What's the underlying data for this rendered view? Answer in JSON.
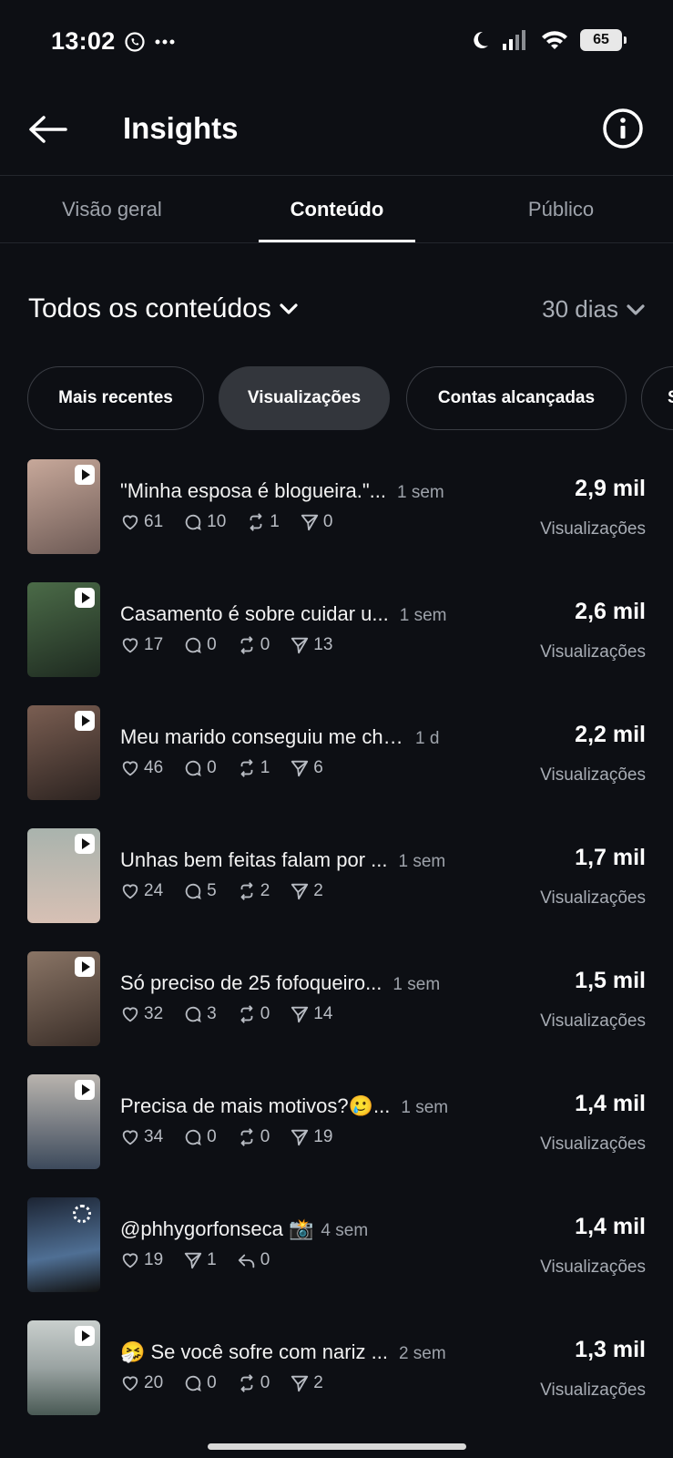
{
  "status_bar": {
    "time": "13:02",
    "battery": "65",
    "icons": [
      "whatsapp-icon",
      "more-dots-icon",
      "moon-icon",
      "signal-icon",
      "wifi-icon",
      "battery-icon"
    ]
  },
  "header": {
    "title": "Insights",
    "back_icon": "arrow-left-icon",
    "info_icon": "info-icon"
  },
  "tabs": [
    {
      "label": "Visão geral",
      "active": false
    },
    {
      "label": "Conteúdo",
      "active": true
    },
    {
      "label": "Público",
      "active": false
    }
  ],
  "filters": {
    "content_label": "Todos os conteúdos",
    "period_label": "30 dias"
  },
  "chips": [
    {
      "label": "Mais recentes",
      "active": false
    },
    {
      "label": "Visualizações",
      "active": true
    },
    {
      "label": "Contas alcançadas",
      "active": false
    },
    {
      "label": "S",
      "active": false
    }
  ],
  "posts": [
    {
      "title": "\"Minha esposa é blogueira.\"...",
      "age": "1 sem",
      "likes": "61",
      "comments": "10",
      "reposts": "1",
      "shares": "0",
      "value": "2,9 mil",
      "label": "Visualizações",
      "media": "video",
      "thumb_colors": [
        "#c7a89a",
        "#6d5a55"
      ]
    },
    {
      "title": "Casamento é sobre cuidar u...",
      "age": "1 sem",
      "likes": "17",
      "comments": "0",
      "reposts": "0",
      "shares": "13",
      "value": "2,6 mil",
      "label": "Visualizações",
      "media": "video",
      "thumb_colors": [
        "#4b6b48",
        "#1e2a20"
      ]
    },
    {
      "title": "Meu marido conseguiu me cha...",
      "age": "1 d",
      "likes": "46",
      "comments": "0",
      "reposts": "1",
      "shares": "6",
      "value": "2,2 mil",
      "label": "Visualizações",
      "media": "video",
      "thumb_colors": [
        "#7a5e52",
        "#2c2320"
      ]
    },
    {
      "title": "Unhas bem feitas falam por ...",
      "age": "1 sem",
      "likes": "24",
      "comments": "5",
      "reposts": "2",
      "shares": "2",
      "value": "1,7 mil",
      "label": "Visualizações",
      "media": "video",
      "thumb_colors": [
        "#a9b3ad",
        "#d7c0b4"
      ]
    },
    {
      "title": "Só preciso de 25 fofoqueiro...",
      "age": "1 sem",
      "likes": "32",
      "comments": "3",
      "reposts": "0",
      "shares": "14",
      "value": "1,5 mil",
      "label": "Visualizações",
      "media": "video",
      "thumb_colors": [
        "#8a7566",
        "#3a2e28"
      ]
    },
    {
      "title": "Precisa de mais motivos?🥲...",
      "age": "1 sem",
      "likes": "34",
      "comments": "0",
      "reposts": "0",
      "shares": "19",
      "value": "1,4 mil",
      "label": "Visualizações",
      "media": "video",
      "thumb_colors": [
        "#b9b4ae",
        "#3d4a5c"
      ]
    },
    {
      "title": "@phhygorfonseca 📸",
      "age": "4 sem",
      "likes": "19",
      "shares": "1",
      "replies": "0",
      "value": "1,4 mil",
      "label": "Visualizações",
      "media": "photo",
      "thumb_colors": [
        "#1c2433",
        "#4f6f94"
      ]
    },
    {
      "title": "🤧 Se você sofre com nariz ...",
      "age": "2 sem",
      "likes": "20",
      "comments": "0",
      "reposts": "0",
      "shares": "2",
      "value": "1,3 mil",
      "label": "Visualizações",
      "media": "video",
      "thumb_colors": [
        "#9aa3a2",
        "#4a5a55"
      ]
    }
  ]
}
